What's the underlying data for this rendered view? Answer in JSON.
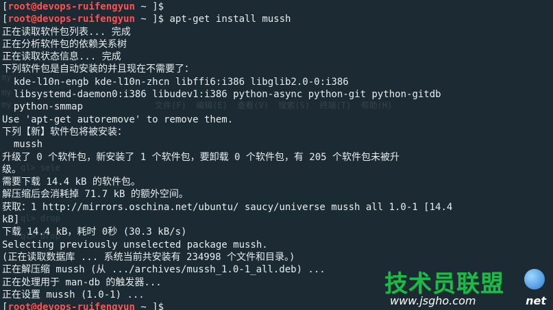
{
  "terminal": {
    "prompt_user_host": "root@devops-ruifengyun",
    "prompt_path": " ~ ",
    "lines": [
      {
        "type": "prompt",
        "cmd": "$"
      },
      {
        "type": "prompt",
        "cmd": "$ apt-get install mussh"
      },
      {
        "type": "text",
        "text": "正在读取软件包列表... 完成"
      },
      {
        "type": "text",
        "text": "正在分析软件包的依赖关系树"
      },
      {
        "type": "text",
        "text": "正在读取状态信息... 完成"
      },
      {
        "type": "text",
        "text": "下列软件包是自动安装的并且现在不需要了："
      },
      {
        "type": "text",
        "text": "  kde-l10n-engb kde-l10n-zhcn libffi6:i386 libglib2.0-0:i386"
      },
      {
        "type": "text",
        "text": "  libsystemd-daemon0:i386 libudev1:i386 python-async python-git python-gitdb"
      },
      {
        "type": "text",
        "text": "  python-smmap"
      },
      {
        "type": "text",
        "text": "Use 'apt-get autoremove' to remove them."
      },
      {
        "type": "text",
        "text": "下列【新】软件包将被安装："
      },
      {
        "type": "text",
        "text": "  mussh"
      },
      {
        "type": "text",
        "text": "升级了 0 个软件包，新安装了 1 个软件包，要卸载 0 个软件包，有 205 个软件包未被升"
      },
      {
        "type": "text",
        "text": "级。"
      },
      {
        "type": "text",
        "text": "需要下载 14.4 kB 的软件包。"
      },
      {
        "type": "text",
        "text": "解压缩后会消耗掉 71.7 kB 的额外空间。"
      },
      {
        "type": "text",
        "text": "获取：1 http://mirrors.oschina.net/ubuntu/ saucy/universe mussh all 1.0-1 [14.4"
      },
      {
        "type": "text",
        "text": "kB]"
      },
      {
        "type": "text",
        "text": "下载 14.4 kB，耗时 0秒 (30.3 kB/s)"
      },
      {
        "type": "text",
        "text": "Selecting previously unselected package mussh."
      },
      {
        "type": "text",
        "text": "(正在读取数据库 ... 系统当前共安装有 234998 个文件和目录。)"
      },
      {
        "type": "text",
        "text": "正在解压缩 mussh (从 .../archives/mussh_1.0-1_all.deb) ..."
      },
      {
        "type": "text",
        "text": "正在处理用于 man-db 的触发器..."
      },
      {
        "type": "text",
        "text": "正在设置 mussh (1.0-1) ..."
      },
      {
        "type": "prompt",
        "cmd": "$"
      }
    ]
  },
  "ghost": {
    "menu": "文件(F)  编辑(E)  查看(V)  搜索(S)  终端(T)  帮助(H)",
    "row1": "my",
    "row2": "my",
    "row3": "my",
    "row4": "ql> sele",
    "row5": "ql> drop",
    "row6": "ql> drop"
  },
  "watermark": {
    "main": "技术员联盟",
    "url": "www.jsgho.com",
    "net": "net"
  },
  "colors": {
    "background": "#1b2a33",
    "foreground": "#e8eef0",
    "prompt_user": "#ff5252",
    "watermark_green": "#1fb84a"
  }
}
